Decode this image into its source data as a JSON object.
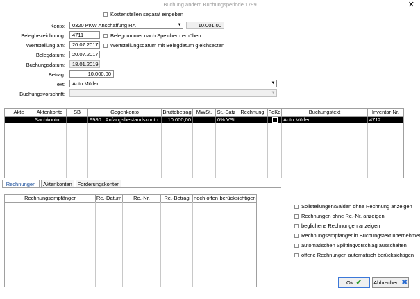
{
  "window": {
    "title": "Buchung ändern Buchungsperiode 1799",
    "close": "✕"
  },
  "form": {
    "kostenstellen": "Kostenstellen separat eingeben",
    "konto_label": "Konto:",
    "konto_value": "0320   PKW Anschaffung RA",
    "konto_saldo": "10.001,00",
    "belegbez_label": "Belegbezeichnung:",
    "belegbez_value": "4711",
    "belegnr_cb": "Belegnummer nach Speichern erhöhen",
    "wertstellung_label": "Wertstellung am:",
    "wertstellung_value": "20.07.2017",
    "wertstellung_cb": "Wertstellungsdatum mit Belegdatum gleichsetzen",
    "belegdatum_label": "Belegdatum:",
    "belegdatum_value": "20.07.2017",
    "buchungsdatum_label": "Buchungsdatum:",
    "buchungsdatum_value": "18.01.2019",
    "betrag_label": "Betrag:",
    "betrag_value": "10.000,00",
    "text_label": "Text:",
    "text_value": "Auto Müller",
    "vorschrift_label": "Buchungsvorschrift:",
    "vorschrift_value": ""
  },
  "grid": {
    "headers": [
      "Akte",
      "Aktenkonto",
      "SB",
      "Gegenkonto",
      "Bruttobetrag",
      "MWSt.",
      "St.-Satz",
      "Rechnung",
      "FoKo",
      "Buchungstext",
      "Inventar-Nr."
    ],
    "row": {
      "akte": "",
      "aktenkonto": "Sachkonto",
      "sb": "",
      "gegenkonto_nr": "9980",
      "gegenkonto_name": "Anfangsbestandskonto",
      "brutto": "10.000,00",
      "mwst": "",
      "satz": "0% VSt.",
      "rechnung": "",
      "buchungstext": "Auto Müller",
      "inventar": "4712"
    }
  },
  "tabs": [
    "Rechnungen",
    "Aktenkonten",
    "Forderungskonten"
  ],
  "grid2": {
    "headers": [
      "Rechnungsempfänger",
      "Re.-Datum",
      "Re.-Nr.",
      "Re.-Betrag",
      "noch offen",
      "berücksichtigen"
    ]
  },
  "options": [
    "Sollstellungen/Salden ohne Rechnung anzeigen",
    "Rechnungen ohne Re.-Nr. anzeigen",
    "beglichene Rechnungen anzeigen",
    "Rechnungsempfänger in Buchungstext übernehmen",
    "automatischen Splittingvorschlag ausschalten",
    "offene Rechnungen automatisch berücksichtigen"
  ],
  "buttons": {
    "ok": "Ok",
    "cancel": "Abbrechen"
  }
}
